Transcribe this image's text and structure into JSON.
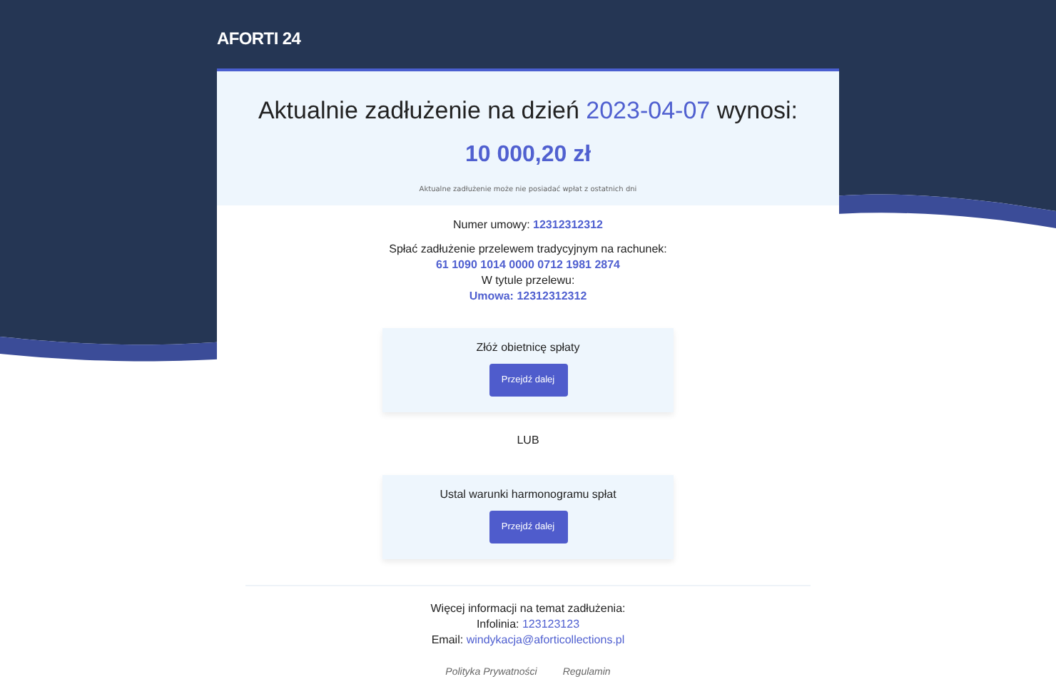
{
  "logo": "AFORTI 24",
  "summary": {
    "heading_before": "Aktualnie zadłużenie na dzień",
    "date": "2023-04-07",
    "heading_after": "wynosi:",
    "amount": "10 000,20 zł",
    "note": "Aktualne zadłużenie może nie posiadać wpłat z ostatnich dni"
  },
  "contract": {
    "label": "Numer umowy:",
    "value": "12312312312"
  },
  "transfer": {
    "instruction": "Spłać zadłużenie przelewem tradycyjnym na rachunek:",
    "account": "61 1090 1014 0000 0712 1981 2874",
    "title_label": "W tytule przelewu:",
    "title_value": "Umowa: 12312312312"
  },
  "options": [
    {
      "title": "Złóż obietnicę spłaty",
      "button": "Przejdź dalej"
    },
    {
      "title": "Ustal warunki harmonogramu spłat",
      "button": "Przejdź dalej"
    }
  ],
  "separator": "LUB",
  "contact": {
    "heading": "Więcej informacji na temat zadłużenia:",
    "phone_label": "Infolinia:",
    "phone": "123123123",
    "email_label": "Email:",
    "email": "windykacja@aforticollections.pl"
  },
  "footer_links": [
    "Polityka Prywatności",
    "Regulamin"
  ]
}
